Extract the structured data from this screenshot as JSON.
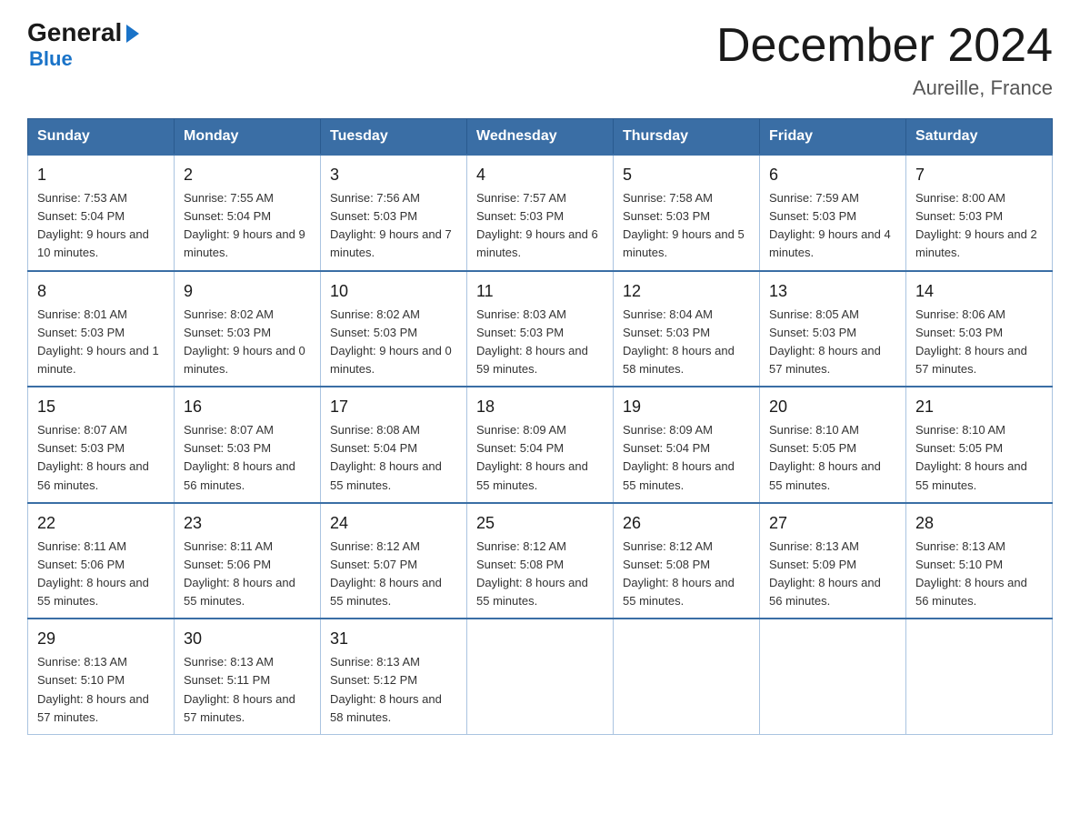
{
  "logo": {
    "general": "General",
    "blue": "Blue"
  },
  "title": "December 2024",
  "subtitle": "Aureille, France",
  "days_of_week": [
    "Sunday",
    "Monday",
    "Tuesday",
    "Wednesday",
    "Thursday",
    "Friday",
    "Saturday"
  ],
  "weeks": [
    [
      {
        "day": "1",
        "sunrise": "7:53 AM",
        "sunset": "5:04 PM",
        "daylight": "9 hours and 10 minutes."
      },
      {
        "day": "2",
        "sunrise": "7:55 AM",
        "sunset": "5:04 PM",
        "daylight": "9 hours and 9 minutes."
      },
      {
        "day": "3",
        "sunrise": "7:56 AM",
        "sunset": "5:03 PM",
        "daylight": "9 hours and 7 minutes."
      },
      {
        "day": "4",
        "sunrise": "7:57 AM",
        "sunset": "5:03 PM",
        "daylight": "9 hours and 6 minutes."
      },
      {
        "day": "5",
        "sunrise": "7:58 AM",
        "sunset": "5:03 PM",
        "daylight": "9 hours and 5 minutes."
      },
      {
        "day": "6",
        "sunrise": "7:59 AM",
        "sunset": "5:03 PM",
        "daylight": "9 hours and 4 minutes."
      },
      {
        "day": "7",
        "sunrise": "8:00 AM",
        "sunset": "5:03 PM",
        "daylight": "9 hours and 2 minutes."
      }
    ],
    [
      {
        "day": "8",
        "sunrise": "8:01 AM",
        "sunset": "5:03 PM",
        "daylight": "9 hours and 1 minute."
      },
      {
        "day": "9",
        "sunrise": "8:02 AM",
        "sunset": "5:03 PM",
        "daylight": "9 hours and 0 minutes."
      },
      {
        "day": "10",
        "sunrise": "8:02 AM",
        "sunset": "5:03 PM",
        "daylight": "9 hours and 0 minutes."
      },
      {
        "day": "11",
        "sunrise": "8:03 AM",
        "sunset": "5:03 PM",
        "daylight": "8 hours and 59 minutes."
      },
      {
        "day": "12",
        "sunrise": "8:04 AM",
        "sunset": "5:03 PM",
        "daylight": "8 hours and 58 minutes."
      },
      {
        "day": "13",
        "sunrise": "8:05 AM",
        "sunset": "5:03 PM",
        "daylight": "8 hours and 57 minutes."
      },
      {
        "day": "14",
        "sunrise": "8:06 AM",
        "sunset": "5:03 PM",
        "daylight": "8 hours and 57 minutes."
      }
    ],
    [
      {
        "day": "15",
        "sunrise": "8:07 AM",
        "sunset": "5:03 PM",
        "daylight": "8 hours and 56 minutes."
      },
      {
        "day": "16",
        "sunrise": "8:07 AM",
        "sunset": "5:03 PM",
        "daylight": "8 hours and 56 minutes."
      },
      {
        "day": "17",
        "sunrise": "8:08 AM",
        "sunset": "5:04 PM",
        "daylight": "8 hours and 55 minutes."
      },
      {
        "day": "18",
        "sunrise": "8:09 AM",
        "sunset": "5:04 PM",
        "daylight": "8 hours and 55 minutes."
      },
      {
        "day": "19",
        "sunrise": "8:09 AM",
        "sunset": "5:04 PM",
        "daylight": "8 hours and 55 minutes."
      },
      {
        "day": "20",
        "sunrise": "8:10 AM",
        "sunset": "5:05 PM",
        "daylight": "8 hours and 55 minutes."
      },
      {
        "day": "21",
        "sunrise": "8:10 AM",
        "sunset": "5:05 PM",
        "daylight": "8 hours and 55 minutes."
      }
    ],
    [
      {
        "day": "22",
        "sunrise": "8:11 AM",
        "sunset": "5:06 PM",
        "daylight": "8 hours and 55 minutes."
      },
      {
        "day": "23",
        "sunrise": "8:11 AM",
        "sunset": "5:06 PM",
        "daylight": "8 hours and 55 minutes."
      },
      {
        "day": "24",
        "sunrise": "8:12 AM",
        "sunset": "5:07 PM",
        "daylight": "8 hours and 55 minutes."
      },
      {
        "day": "25",
        "sunrise": "8:12 AM",
        "sunset": "5:08 PM",
        "daylight": "8 hours and 55 minutes."
      },
      {
        "day": "26",
        "sunrise": "8:12 AM",
        "sunset": "5:08 PM",
        "daylight": "8 hours and 55 minutes."
      },
      {
        "day": "27",
        "sunrise": "8:13 AM",
        "sunset": "5:09 PM",
        "daylight": "8 hours and 56 minutes."
      },
      {
        "day": "28",
        "sunrise": "8:13 AM",
        "sunset": "5:10 PM",
        "daylight": "8 hours and 56 minutes."
      }
    ],
    [
      {
        "day": "29",
        "sunrise": "8:13 AM",
        "sunset": "5:10 PM",
        "daylight": "8 hours and 57 minutes."
      },
      {
        "day": "30",
        "sunrise": "8:13 AM",
        "sunset": "5:11 PM",
        "daylight": "8 hours and 57 minutes."
      },
      {
        "day": "31",
        "sunrise": "8:13 AM",
        "sunset": "5:12 PM",
        "daylight": "8 hours and 58 minutes."
      },
      null,
      null,
      null,
      null
    ]
  ]
}
